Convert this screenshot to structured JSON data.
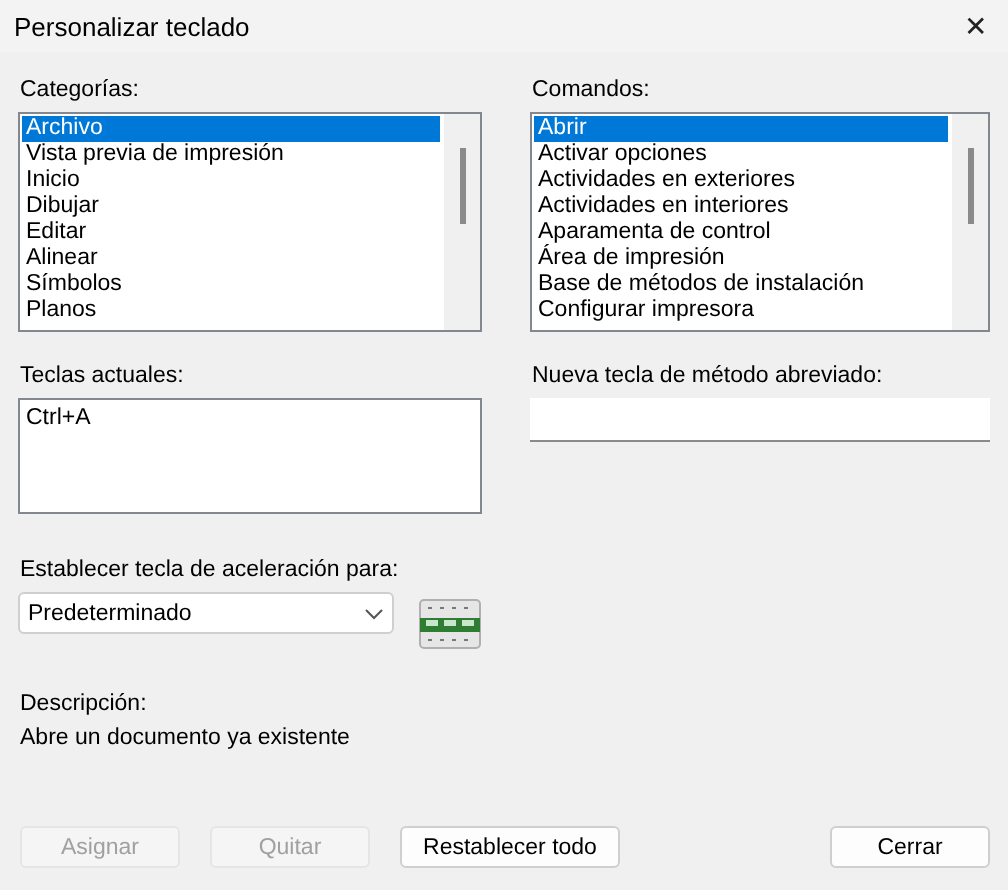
{
  "window": {
    "title": "Personalizar teclado",
    "close": "✕"
  },
  "categories": {
    "label": "Categorías:",
    "items": [
      {
        "text": "Archivo",
        "selected": true
      },
      {
        "text": "Vista previa de impresión",
        "selected": false
      },
      {
        "text": "Inicio",
        "selected": false
      },
      {
        "text": "Dibujar",
        "selected": false
      },
      {
        "text": "Editar",
        "selected": false
      },
      {
        "text": "Alinear",
        "selected": false
      },
      {
        "text": "Símbolos",
        "selected": false
      },
      {
        "text": "Planos",
        "selected": false
      }
    ]
  },
  "commands": {
    "label": "Comandos:",
    "items": [
      {
        "text": "Abrir",
        "selected": true
      },
      {
        "text": "Activar opciones",
        "selected": false
      },
      {
        "text": "Actividades en exteriores",
        "selected": false
      },
      {
        "text": "Actividades en interiores",
        "selected": false
      },
      {
        "text": "Aparamenta de control",
        "selected": false
      },
      {
        "text": "Área de impresión",
        "selected": false
      },
      {
        "text": "Base de métodos de instalación",
        "selected": false
      },
      {
        "text": "Configurar impresora",
        "selected": false
      }
    ]
  },
  "current_keys": {
    "label": "Teclas actuales:",
    "items": [
      "Ctrl+A"
    ]
  },
  "new_shortcut": {
    "label": "Nueva tecla de método abreviado:"
  },
  "accelerator": {
    "label": "Establecer tecla de aceleración para:",
    "value": "Predeterminado"
  },
  "description": {
    "label": "Descripción:",
    "text": "Abre un documento ya existente"
  },
  "buttons": [
    {
      "label": "Asignar",
      "disabled": true
    },
    {
      "label": "Quitar",
      "disabled": true
    },
    {
      "label": "Restablecer todo",
      "disabled": false
    },
    {
      "label": "Cerrar",
      "disabled": false
    }
  ]
}
